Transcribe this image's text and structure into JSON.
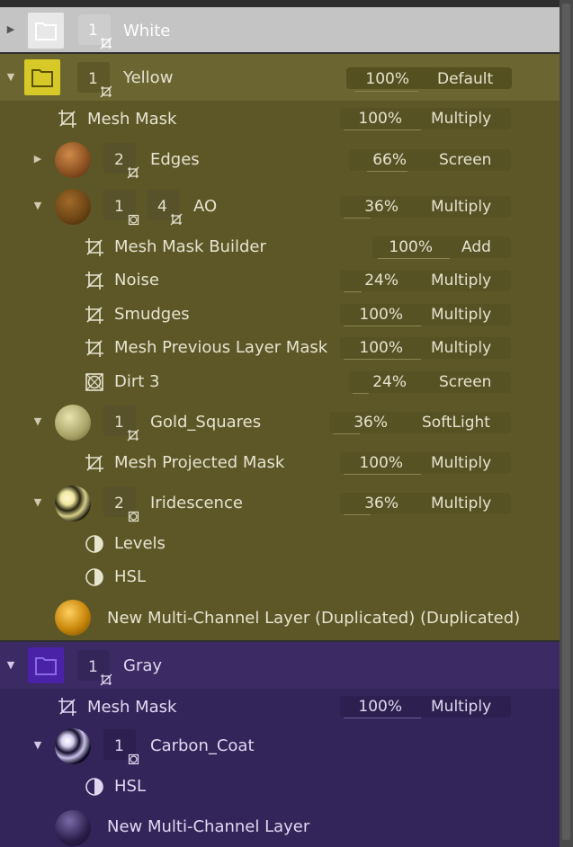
{
  "groups": [
    {
      "name": "White",
      "count": "1"
    },
    {
      "name": "Yellow",
      "count": "1",
      "opacity": "100%",
      "blend": "Default"
    },
    {
      "name": "Gray",
      "count": "1"
    }
  ],
  "yellow": {
    "mesh_mask": {
      "name": "Mesh Mask",
      "opacity": "100%",
      "blend": "Multiply"
    },
    "edges": {
      "name": "Edges",
      "count": "2",
      "opacity": "66%",
      "blend": "Screen"
    },
    "ao": {
      "name": "AO",
      "count1": "1",
      "count2": "4",
      "opacity": "36%",
      "blend": "Multiply"
    },
    "ao_children": [
      {
        "name": "Mesh Mask Builder",
        "opacity": "100%",
        "blend": "Add",
        "icon": "crop-mask-icon"
      },
      {
        "name": "Noise",
        "opacity": "24%",
        "blend": "Multiply",
        "icon": "crop-mask-icon"
      },
      {
        "name": "Smudges",
        "opacity": "100%",
        "blend": "Multiply",
        "icon": "crop-mask-icon"
      },
      {
        "name": "Mesh Previous Layer Mask",
        "opacity": "100%",
        "blend": "Multiply",
        "icon": "crop-mask-icon"
      },
      {
        "name": "Dirt 3",
        "opacity": "24%",
        "blend": "Screen",
        "icon": "generator-icon"
      }
    ],
    "gold": {
      "name": "Gold_Squares",
      "count": "1",
      "opacity": "36%",
      "blend": "SoftLight"
    },
    "gold_children": [
      {
        "name": "Mesh Projected Mask",
        "opacity": "100%",
        "blend": "Multiply",
        "icon": "crop-mask-icon"
      }
    ],
    "iridescence": {
      "name": "Iridescence",
      "count": "2",
      "opacity": "36%",
      "blend": "Multiply"
    },
    "iri_children": [
      {
        "name": "Levels",
        "icon": "adjustment-icon"
      },
      {
        "name": "HSL",
        "icon": "adjustment-icon"
      }
    ],
    "new_layer": {
      "name": "New Multi-Channel Layer (Duplicated) (Duplicated)"
    }
  },
  "gray": {
    "mesh_mask": {
      "name": "Mesh Mask",
      "opacity": "100%",
      "blend": "Multiply"
    },
    "carbon": {
      "name": "Carbon_Coat",
      "count": "1"
    },
    "carbon_children": [
      {
        "name": "HSL",
        "icon": "adjustment-icon"
      }
    ],
    "new_layer": {
      "name": "New Multi-Channel Layer"
    }
  },
  "colors": {
    "white_group": "#c9c9c9",
    "yellow_group": "#6b6532",
    "yellow_bg": "#5d5727",
    "gray_group": "#3b2a63",
    "gray_bg": "#33245a"
  }
}
